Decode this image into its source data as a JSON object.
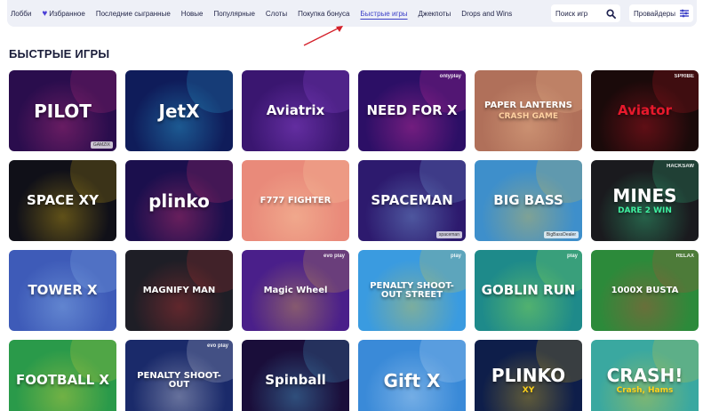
{
  "nav": {
    "items": [
      {
        "label": "Лобби"
      },
      {
        "label": "Избранное"
      },
      {
        "label": "Последние сыгранные"
      },
      {
        "label": "Новые"
      },
      {
        "label": "Популярные"
      },
      {
        "label": "Слоты"
      },
      {
        "label": "Покупка бонуса"
      },
      {
        "label": "Быстрые игры"
      },
      {
        "label": "Джекпоты"
      },
      {
        "label": "Drops and Wins"
      }
    ],
    "active_index": 7,
    "search_placeholder": "Поиск игр",
    "providers_label": "Провайдеры"
  },
  "section_title": "БЫСТРЫЕ ИГРЫ",
  "games": [
    {
      "title": "PILOT",
      "badge": "",
      "footer": "GAMZIX",
      "bg": "#2a0d4d",
      "accent": "#e23a8c"
    },
    {
      "title": "JetX",
      "badge": "",
      "footer": "",
      "bg": "#0f1c5a",
      "accent": "#36d3ff"
    },
    {
      "title": "Aviatrix",
      "badge": "",
      "footer": "",
      "bg": "#3a1670",
      "accent": "#b45cff"
    },
    {
      "title": "NEED FOR X",
      "badge": "onlyplay",
      "footer": "",
      "bg": "#2c0f66",
      "accent": "#ff3ab0"
    },
    {
      "title": "PAPER LANTERNS",
      "subtitle": "CRASH GAME",
      "badge": "",
      "footer": "",
      "bg": "#b0705a",
      "accent": "#ffd0a0"
    },
    {
      "title": "Aviator",
      "badge": "SPRIBE",
      "footer": "",
      "bg": "#1a0a0a",
      "accent": "#e8192c"
    },
    {
      "title": "SPACE XY",
      "badge": "",
      "footer": "",
      "bg": "#101018",
      "accent": "#ffd21a"
    },
    {
      "title": "plinko",
      "badge": "",
      "footer": "",
      "bg": "#1b0f4d",
      "accent": "#ff3e7a"
    },
    {
      "title": "F777 FIGHTER",
      "badge": "",
      "footer": "",
      "bg": "#e98a7a",
      "accent": "#ffe3b0"
    },
    {
      "title": "SPACEMAN",
      "badge": "",
      "footer": "spaceman",
      "bg": "#2d1a6e",
      "accent": "#8fd0ff"
    },
    {
      "title": "BIG BASS",
      "badge": "",
      "footer": "BigBassDealer",
      "bg": "#3e8fcb",
      "accent": "#ffc72a"
    },
    {
      "title": "MINES",
      "subtitle": "DARE 2 WIN",
      "badge": "HACKSAW",
      "footer": "",
      "bg": "#1a1a1e",
      "accent": "#3ff0a0"
    },
    {
      "title": "TOWER X",
      "badge": "",
      "footer": "",
      "bg": "#3e5bb8",
      "accent": "#a8d8ff"
    },
    {
      "title": "MAGNIFY MAN",
      "badge": "",
      "footer": "",
      "bg": "#1e1e26",
      "accent": "#e53a3a"
    },
    {
      "title": "Magic Wheel",
      "badge": "evo play",
      "footer": "",
      "bg": "#4a1f8a",
      "accent": "#ffcf3a"
    },
    {
      "title": "PENALTY SHOOT-OUT STREET",
      "badge": "play",
      "footer": "",
      "bg": "#3a9be0",
      "accent": "#ffd21a"
    },
    {
      "title": "GOBLIN RUN",
      "badge": "play",
      "footer": "",
      "bg": "#1e8a8a",
      "accent": "#b8ff3a"
    },
    {
      "title": "1000X BUSTA",
      "badge": "RELAX",
      "footer": "",
      "bg": "#2c8a3a",
      "accent": "#e23a3a"
    },
    {
      "title": "FOOTBALL X",
      "badge": "",
      "footer": "",
      "bg": "#2a9a4a",
      "accent": "#ffe03a"
    },
    {
      "title": "PENALTY SHOOT-OUT",
      "badge": "evo play",
      "footer": "",
      "bg": "#1a2a6a",
      "accent": "#ffffff"
    },
    {
      "title": "Spinball",
      "badge": "",
      "footer": "",
      "bg": "#1a0e3a",
      "accent": "#5ad0ff"
    },
    {
      "title": "Gift X",
      "badge": "",
      "footer": "",
      "bg": "#3a8ad8",
      "accent": "#e8f4ff"
    },
    {
      "title": "PLINKO",
      "subtitle": "XY",
      "badge": "",
      "footer": "",
      "bg": "#0e1e4a",
      "accent": "#ffd21a"
    },
    {
      "title": "CRASH!",
      "subtitle": "Crash, Hams",
      "badge": "",
      "footer": "",
      "bg": "#3aa8a0",
      "accent": "#ffd21a"
    }
  ]
}
